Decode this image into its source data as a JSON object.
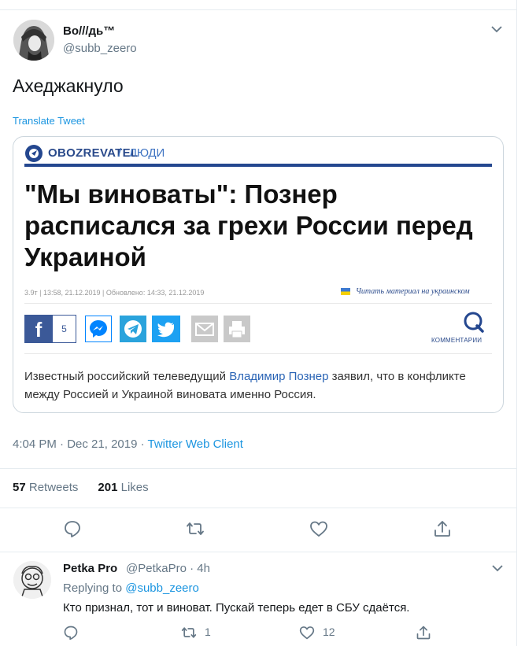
{
  "tweet": {
    "author_name": "Во///дь™",
    "author_handle": "@subb_zeero",
    "text": "Ахеджакнуло",
    "translate_label": "Translate Tweet",
    "time": "4:04 PM",
    "date": "Dec 21, 2019",
    "source": "Twitter Web Client",
    "retweets_count": "57",
    "retweets_label": "Retweets",
    "likes_count": "201",
    "likes_label": "Likes"
  },
  "card": {
    "brand": "OBOZREVATEL",
    "separator": "/",
    "section": "ЛЮДИ",
    "headline": "\"Мы виноваты\": Познер расписался за грехи России перед Украиной",
    "meta": "3.9т  |  13:58, 21.12.2019  |  Обновлено: 14:33, 21.12.2019",
    "ua_link": "Читать материал на украинском",
    "fb_count": "5",
    "comments_label": "КОММЕНТАРИИ",
    "lead_before": "Известный российский телеведущий ",
    "lead_link": "Владимир Познер",
    "lead_after": " заявил, что в конфликте между Россией и Украиной виновата именно Россия."
  },
  "reply": {
    "author_name": "Petka Pro",
    "author_handle": "@PetkaPro",
    "dot": "·",
    "age": "4h",
    "replying_label": "Replying to",
    "replying_handle": "@subb_zeero",
    "text": "Кто признал, тот и виноват. Пускай теперь едет в СБУ сдаётся.",
    "retweets": "1",
    "likes": "12"
  },
  "colors": {
    "accent": "#1b95e0",
    "muted": "#657786",
    "brand": "#24478f",
    "facebook": "#3b5998",
    "messenger": "#0084ff",
    "telegram": "#2aa3dc",
    "twitter": "#1da1f2"
  },
  "icons": {
    "more": "chevron-down-icon",
    "reply": "speech-bubble-icon",
    "retweet": "retweet-icon",
    "like": "heart-icon",
    "share": "share-icon"
  }
}
